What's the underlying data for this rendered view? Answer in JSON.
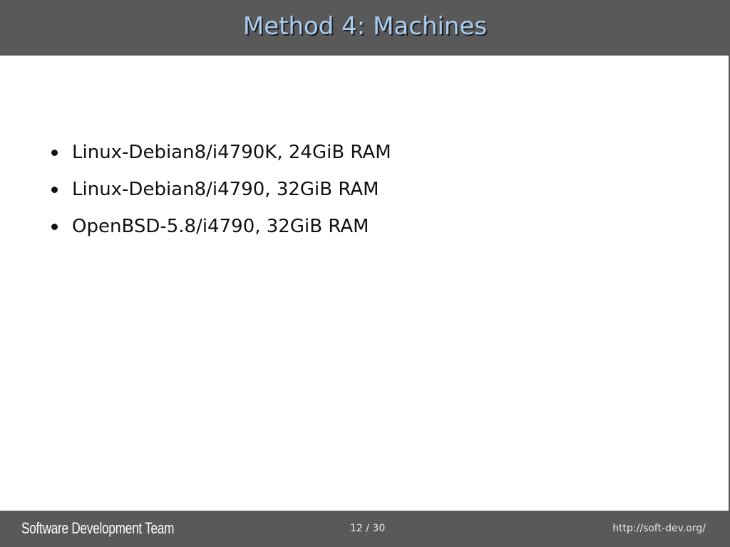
{
  "slide": {
    "title": "Method 4: Machines",
    "bullets": [
      {
        "text": "Linux-Debian8/i4790K, 24GiB RAM"
      },
      {
        "text": "Linux-Debian8/i4790, 32GiB RAM"
      },
      {
        "text": "OpenBSD-5.8/i4790, 32GiB RAM"
      }
    ]
  },
  "footer": {
    "brand": "Software Development Team",
    "page_indicator": "12 / 30",
    "url": "http://soft-dev.org/"
  },
  "colors": {
    "header_background": "#595959",
    "title_text": "#a9cdf0",
    "body_background": "#ffffff",
    "body_text": "#111111"
  }
}
